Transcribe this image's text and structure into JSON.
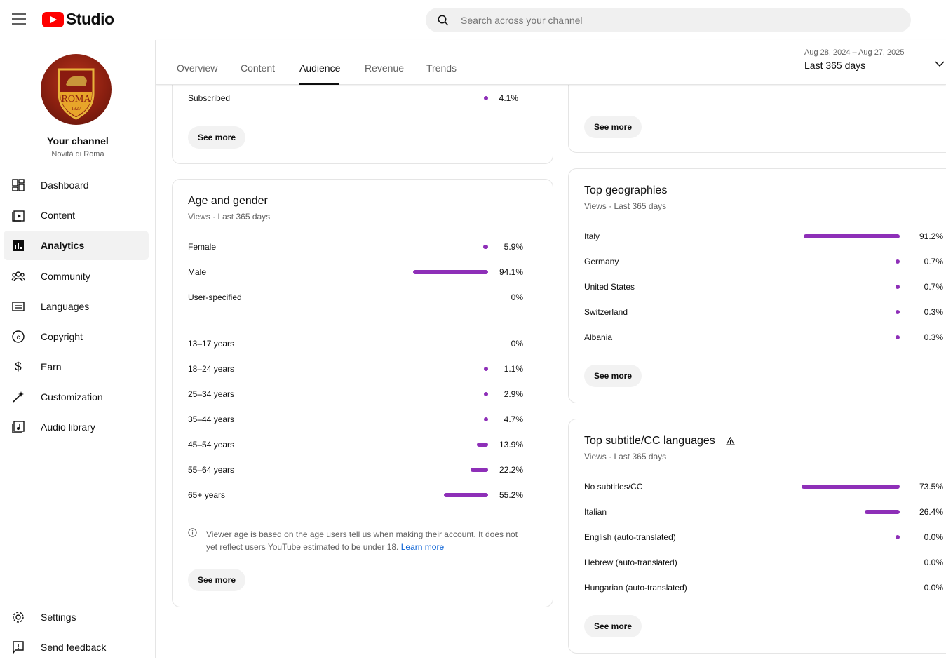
{
  "header": {
    "app_name": "Studio",
    "search_placeholder": "Search across your channel"
  },
  "sidebar": {
    "channel_title": "Your channel",
    "channel_name": "Novità di Roma",
    "items": [
      {
        "label": "Dashboard",
        "icon": "dashboard-icon"
      },
      {
        "label": "Content",
        "icon": "content-icon"
      },
      {
        "label": "Analytics",
        "icon": "analytics-icon",
        "active": true
      },
      {
        "label": "Community",
        "icon": "community-icon"
      },
      {
        "label": "Languages",
        "icon": "languages-icon"
      },
      {
        "label": "Copyright",
        "icon": "copyright-icon"
      },
      {
        "label": "Earn",
        "icon": "earn-icon"
      },
      {
        "label": "Customization",
        "icon": "customization-icon"
      },
      {
        "label": "Audio library",
        "icon": "audio-library-icon"
      }
    ],
    "bottom_items": [
      {
        "label": "Settings",
        "icon": "gear-icon"
      },
      {
        "label": "Send feedback",
        "icon": "feedback-icon"
      }
    ]
  },
  "tabs": [
    "Overview",
    "Content",
    "Audience",
    "Revenue",
    "Trends"
  ],
  "active_tab": "Audience",
  "date_range": {
    "dates": "Aug 28, 2024 – Aug 27, 2025",
    "label": "Last 365 days"
  },
  "subscribed_card": {
    "row": {
      "label": "Subscribed",
      "value": "4.1%",
      "pct": 4.1
    },
    "see_more": "See more"
  },
  "age_gender": {
    "title": "Age and gender",
    "subtitle": "Views · Last 365 days",
    "gender": [
      {
        "label": "Female",
        "value": "5.9%",
        "pct": 5.9
      },
      {
        "label": "Male",
        "value": "94.1%",
        "pct": 94.1
      },
      {
        "label": "User-specified",
        "value": "0%",
        "pct": 0
      }
    ],
    "ages": [
      {
        "label": "13–17 years",
        "value": "0%",
        "pct": 0
      },
      {
        "label": "18–24 years",
        "value": "1.1%",
        "pct": 1.1
      },
      {
        "label": "25–34 years",
        "value": "2.9%",
        "pct": 2.9
      },
      {
        "label": "35–44 years",
        "value": "4.7%",
        "pct": 4.7
      },
      {
        "label": "45–54 years",
        "value": "13.9%",
        "pct": 13.9
      },
      {
        "label": "55–64 years",
        "value": "22.2%",
        "pct": 22.2
      },
      {
        "label": "65+ years",
        "value": "55.2%",
        "pct": 55.2
      }
    ],
    "note": "Viewer age is based on the age users tell us when making their account. It does not yet reflect users YouTube estimated to be under 18.",
    "note_link": "Learn more",
    "see_more": "See more"
  },
  "device_card": {
    "see_more": "See more"
  },
  "geographies": {
    "title": "Top geographies",
    "subtitle": "Views · Last 365 days",
    "rows": [
      {
        "label": "Italy",
        "value": "91.2%",
        "pct": 91.2
      },
      {
        "label": "Germany",
        "value": "0.7%",
        "pct": 0.7
      },
      {
        "label": "United States",
        "value": "0.7%",
        "pct": 0.7
      },
      {
        "label": "Switzerland",
        "value": "0.3%",
        "pct": 0.3
      },
      {
        "label": "Albania",
        "value": "0.3%",
        "pct": 0.3
      }
    ],
    "see_more": "See more"
  },
  "subtitles": {
    "title": "Top subtitle/CC languages",
    "subtitle": "Views · Last 365 days",
    "rows": [
      {
        "label": "No subtitles/CC",
        "value": "73.5%",
        "pct": 73.5
      },
      {
        "label": "Italian",
        "value": "26.4%",
        "pct": 26.4
      },
      {
        "label": "English (auto-translated)",
        "value": "0.0%",
        "pct": 0.01
      },
      {
        "label": "Hebrew (auto-translated)",
        "value": "0.0%",
        "pct": 0
      },
      {
        "label": "Hungarian (auto-translated)",
        "value": "0.0%",
        "pct": 0
      }
    ],
    "see_more": "See more"
  },
  "colors": {
    "bar": "#8e2fb8",
    "brand": "#ff0000"
  }
}
